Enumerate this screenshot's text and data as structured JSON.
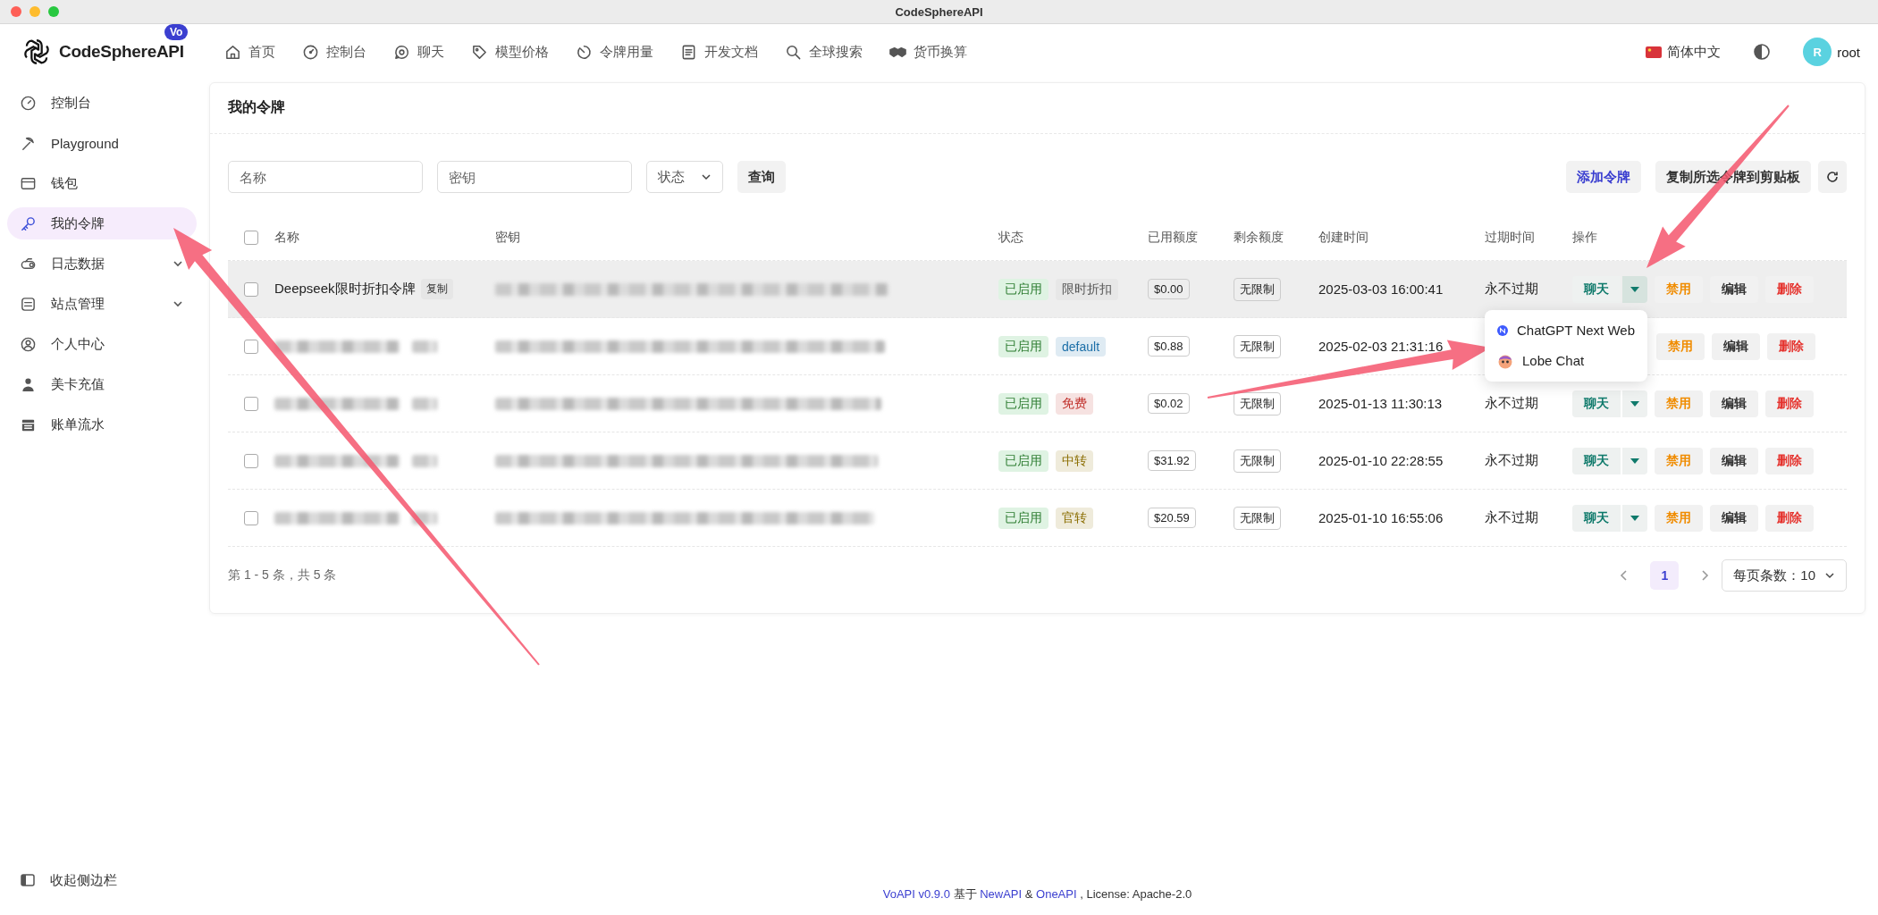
{
  "window": {
    "title": "CodeSphereAPI"
  },
  "brand": {
    "name": "CodeSphereAPI",
    "badge": "Vo"
  },
  "nav": [
    {
      "label": "首页"
    },
    {
      "label": "控制台"
    },
    {
      "label": "聊天"
    },
    {
      "label": "模型价格"
    },
    {
      "label": "令牌用量"
    },
    {
      "label": "开发文档"
    },
    {
      "label": "全球搜索"
    },
    {
      "label": "货币换算"
    }
  ],
  "language": "简体中文",
  "user": {
    "initial": "R",
    "name": "root"
  },
  "sidebar": {
    "items": [
      {
        "label": "控制台",
        "selected": false
      },
      {
        "label": "Playground",
        "selected": false
      },
      {
        "label": "钱包",
        "selected": false
      },
      {
        "label": "我的令牌",
        "selected": true
      },
      {
        "label": "日志数据",
        "selected": false,
        "expanded": false
      },
      {
        "label": "站点管理",
        "selected": false,
        "expanded": false
      },
      {
        "label": "个人中心",
        "selected": false
      },
      {
        "label": "美卡充值",
        "selected": false
      },
      {
        "label": "账单流水",
        "selected": false
      }
    ],
    "collapse": "收起侧边栏"
  },
  "card": {
    "title": "我的令牌"
  },
  "filters": {
    "name_placeholder": "名称",
    "key_placeholder": "密钥",
    "status_select": "状态",
    "query_button": "查询",
    "add_button": "添加令牌",
    "copy_button": "复制所选令牌到剪贴板"
  },
  "table": {
    "header_checked": false,
    "columns": [
      "名称",
      "密钥",
      "状态",
      "已用额度",
      "剩余额度",
      "创建时间",
      "过期时间",
      "操作"
    ],
    "rows": [
      {
        "checked": false,
        "highlighted": true,
        "name": "Deepseek限时折扣令牌",
        "copy_tag": "复制",
        "status": "已启用",
        "group": {
          "label": "限时折扣",
          "color": "#555555"
        },
        "used": "$0.00",
        "remaining": "无限制",
        "created": "2025-03-03 16:00:41",
        "expires": "永不过期",
        "chat": "聊天",
        "menu_open": true,
        "actions": [
          "禁用",
          "编辑",
          "删除"
        ]
      },
      {
        "checked": false,
        "highlighted": false,
        "status": "已启用",
        "group": {
          "label": "default",
          "color": "#1c6fa8"
        },
        "used": "$0.88",
        "remaining": "无限制",
        "created": "2025-02-03 21:31:16",
        "menu_open": false,
        "actions": [
          "禁用",
          "编辑",
          "删除"
        ]
      },
      {
        "checked": false,
        "highlighted": false,
        "status": "已启用",
        "group": {
          "label": "免费",
          "color": "#c0302b"
        },
        "used": "$0.02",
        "remaining": "无限制",
        "created": "2025-01-13 11:30:13",
        "expires": "永不过期",
        "chat": "聊天",
        "menu_open": false,
        "actions": [
          "禁用",
          "编辑",
          "删除"
        ]
      },
      {
        "checked": false,
        "highlighted": false,
        "status": "已启用",
        "group": {
          "label": "中转",
          "color": "#8a6d00"
        },
        "used": "$31.92",
        "remaining": "无限制",
        "created": "2025-01-10 22:28:55",
        "expires": "永不过期",
        "chat": "聊天",
        "menu_open": false,
        "actions": [
          "禁用",
          "编辑",
          "删除"
        ]
      },
      {
        "checked": false,
        "highlighted": false,
        "status": "已启用",
        "group": {
          "label": "官转",
          "color": "#8a6d00"
        },
        "used": "$20.59",
        "remaining": "无限制",
        "created": "2025-01-10 16:55:06",
        "expires": "永不过期",
        "chat": "聊天",
        "menu_open": false,
        "actions": [
          "禁用",
          "编辑",
          "删除"
        ]
      }
    ]
  },
  "chat_menu": {
    "items": [
      {
        "label": "ChatGPT Next Web"
      },
      {
        "label": "Lobe Chat"
      }
    ]
  },
  "pagination": {
    "summary": "第 1 - 5 条，共 5 条",
    "pages": [
      {
        "label": "1",
        "selected": true
      }
    ],
    "page_size": "每页条数：10"
  },
  "footer": [
    {
      "text": "VoAPI v0.9.0",
      "link": true
    },
    {
      "text": " 基于 ",
      "link": false
    },
    {
      "text": "NewAPI",
      "link": true
    },
    {
      "text": " & ",
      "link": false
    },
    {
      "text": "OneAPI",
      "link": true
    },
    {
      "text": " , License: Apache-2.0",
      "link": false
    }
  ]
}
